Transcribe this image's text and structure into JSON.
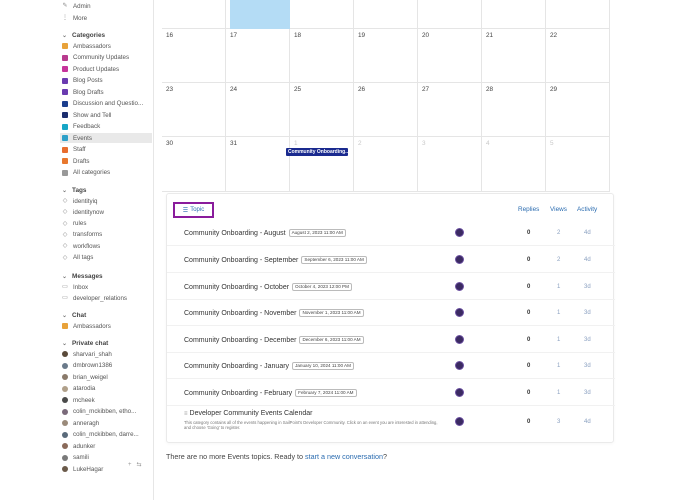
{
  "sidebar": {
    "top": [
      {
        "label": "Admin",
        "icon": "wrench-icon"
      },
      {
        "label": "More",
        "icon": "more-vertical-icon"
      }
    ],
    "categories_heading": "Categories",
    "categories": [
      {
        "label": "Ambassadors",
        "color": "#e8a23a"
      },
      {
        "label": "Community Updates",
        "color": "#b83b8e"
      },
      {
        "label": "Product Updates",
        "color": "#c6349b"
      },
      {
        "label": "Blog Posts",
        "color": "#6a3bb0"
      },
      {
        "label": "Blog Drafts",
        "color": "#6a3bb0"
      },
      {
        "label": "Discussion and Questio...",
        "color": "#1c3e8e"
      },
      {
        "label": "Show and Tell",
        "color": "#1c2d6e"
      },
      {
        "label": "Feedback",
        "color": "#17a6c6"
      },
      {
        "label": "Events",
        "color": "#2ea0c8"
      },
      {
        "label": "Staff",
        "color": "#e86d2e"
      },
      {
        "label": "Drafts",
        "color": "#e8782e"
      },
      {
        "label": "All categories",
        "color": "#999999"
      }
    ],
    "tags_heading": "Tags",
    "tags": [
      "identityiq",
      "identitynow",
      "rules",
      "transforms",
      "workflows",
      "All tags"
    ],
    "messages_heading": "Messages",
    "messages": [
      "Inbox",
      "developer_relations"
    ],
    "chat_heading": "Chat",
    "chat": [
      "Ambassadors"
    ],
    "private_chat_heading": "Private chat",
    "private_chat": [
      "sharvari_shah",
      "dmbrown1386",
      "brian_weigel",
      "atarodia",
      "mcheek",
      "colin_mckibben, etho...",
      "anneragh",
      "colin_mckibben, darre...",
      "adunker",
      "samili",
      "LukeHagar"
    ],
    "bottom_plus": "+",
    "bottom_toggle": "⇆"
  },
  "calendar": {
    "rows": [
      [
        "",
        "",
        "",
        "",
        "",
        "",
        ""
      ],
      [
        "16",
        "17",
        "18",
        "19",
        "20",
        "21",
        "22"
      ],
      [
        "23",
        "24",
        "25",
        "26",
        "27",
        "28",
        "29"
      ],
      [
        "30",
        "31",
        "1",
        "2",
        "3",
        "4",
        "5"
      ]
    ],
    "event_label": "Community Onboarding..."
  },
  "topics": {
    "header": {
      "topic": "Topic",
      "replies": "Replies",
      "views": "Views",
      "activity": "Activity"
    },
    "rows": [
      {
        "title": "Community Onboarding - August",
        "date": "August 2, 2023 11:00 AM",
        "replies": "0",
        "views": "2",
        "activity": "4d"
      },
      {
        "title": "Community Onboarding - September",
        "date": "September 6, 2023 11:00 AM",
        "replies": "0",
        "views": "2",
        "activity": "4d"
      },
      {
        "title": "Community Onboarding - October",
        "date": "October 4, 2023 12:00 PM",
        "replies": "0",
        "views": "1",
        "activity": "3d"
      },
      {
        "title": "Community Onboarding - November",
        "date": "November 1, 2023 11:00 AM",
        "replies": "0",
        "views": "1",
        "activity": "3d"
      },
      {
        "title": "Community Onboarding - December",
        "date": "December 6, 2023 11:00 AM",
        "replies": "0",
        "views": "1",
        "activity": "3d"
      },
      {
        "title": "Community Onboarding - January",
        "date": "January 10, 2024 11:00 AM",
        "replies": "0",
        "views": "1",
        "activity": "3d"
      },
      {
        "title": "Community Onboarding - February",
        "date": "February 7, 2024 11:00 AM",
        "replies": "0",
        "views": "1",
        "activity": "3d"
      }
    ],
    "pinned": {
      "title": "Developer Community Events Calendar",
      "description": "This category contains all of the events happening in SailPoint's Developer Community. Click on an event you are interested in attending, and choose 'Going' to register.",
      "replies": "0",
      "views": "3",
      "activity": "4d"
    }
  },
  "footer": {
    "text": "There are no more Events topics. Ready to ",
    "link": "start a new conversation",
    "end": "?"
  }
}
